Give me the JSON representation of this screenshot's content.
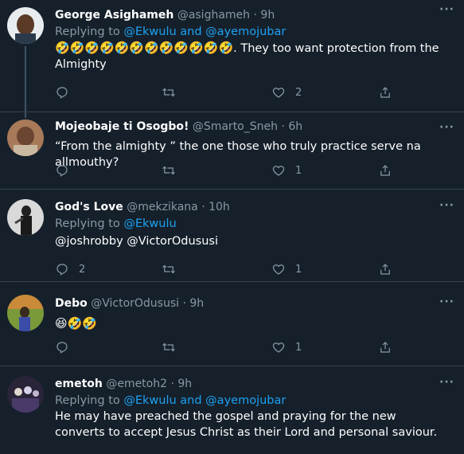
{
  "tweets": [
    {
      "name": "George Asighameh",
      "handle": "@asighameh",
      "time": "9h",
      "replying_prefix": "Replying to",
      "replying_mentions": "@Ekwulu and @ayemojubar",
      "emoji_run": "🤣🤣🤣🤣🤣🤣🤣🤣🤣🤣🤣🤣",
      "text": ". They too want protection from the Almighty",
      "reply_count": "",
      "like_count": "2"
    },
    {
      "name": "Mojeobaje ti Osogbo!",
      "handle": "@Smarto_Sneh",
      "time": "6h",
      "text": "“From the almighty ” the one those who truly practice serve na allmouthy?",
      "reply_count": "",
      "like_count": "1"
    },
    {
      "name": "God's Love",
      "handle": "@mekzikana",
      "time": "10h",
      "replying_prefix": "Replying to",
      "replying_mentions": "@Ekwulu",
      "mentions_line": "@joshrobby @VictorOdususi",
      "reply_count": "2",
      "like_count": "1"
    },
    {
      "name": "Debo",
      "handle": "@VictorOdususi",
      "time": "9h",
      "emoji_text": "😆🤣🤣",
      "reply_count": "",
      "like_count": "1"
    },
    {
      "name": "emetoh",
      "handle": "@emetoh2",
      "time": "9h",
      "replying_prefix": "Replying to",
      "replying_mentions": "@Ekwulu and @ayemojubar",
      "text": "He may have preached the gospel and praying  for the new converts to accept Jesus Christ as their Lord and personal saviour."
    }
  ],
  "separator": "·",
  "more_label": "···",
  "colors": {
    "background": "#15202b",
    "accent": "#1da1f2",
    "muted": "#8899a6",
    "divider": "#38444d"
  },
  "icons": [
    "reply-icon",
    "retweet-icon",
    "like-icon",
    "share-icon",
    "more-icon"
  ]
}
